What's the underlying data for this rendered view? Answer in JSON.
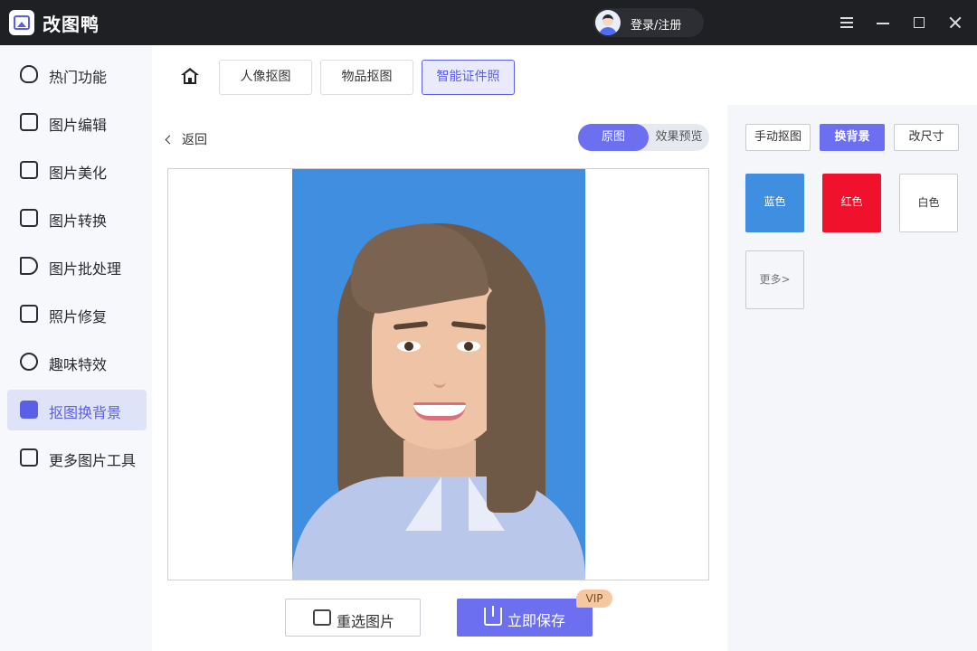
{
  "app": {
    "name": "改图鸭",
    "login_label": "登录/注册"
  },
  "sidebar": {
    "items": [
      {
        "label": "热门功能"
      },
      {
        "label": "图片编辑"
      },
      {
        "label": "图片美化"
      },
      {
        "label": "图片转换"
      },
      {
        "label": "图片批处理"
      },
      {
        "label": "照片修复"
      },
      {
        "label": "趣味特效"
      },
      {
        "label": "抠图换背景",
        "active": true
      },
      {
        "label": "更多图片工具"
      }
    ]
  },
  "tabs": [
    {
      "label": "人像抠图"
    },
    {
      "label": "物品抠图"
    },
    {
      "label": "智能证件照",
      "active": true
    }
  ],
  "main": {
    "back_label": "返回",
    "toggle": {
      "original": "原图",
      "preview": "效果预览"
    },
    "reselect_label": "重选图片",
    "save_label": "立即保存",
    "vip_badge": "VIP"
  },
  "panel": {
    "tabs": [
      {
        "label": "手动抠图"
      },
      {
        "label": "换背景",
        "active": true
      },
      {
        "label": "改尺寸"
      }
    ],
    "colors": [
      {
        "label": "蓝色",
        "hex": "#3f8ee0"
      },
      {
        "label": "红色",
        "hex": "#f0122d"
      },
      {
        "label": "白色",
        "hex": "#ffffff"
      }
    ],
    "more_label": "更多>"
  },
  "theme": {
    "accent": "#6b6ff0",
    "titlebar": "#1f2023"
  }
}
